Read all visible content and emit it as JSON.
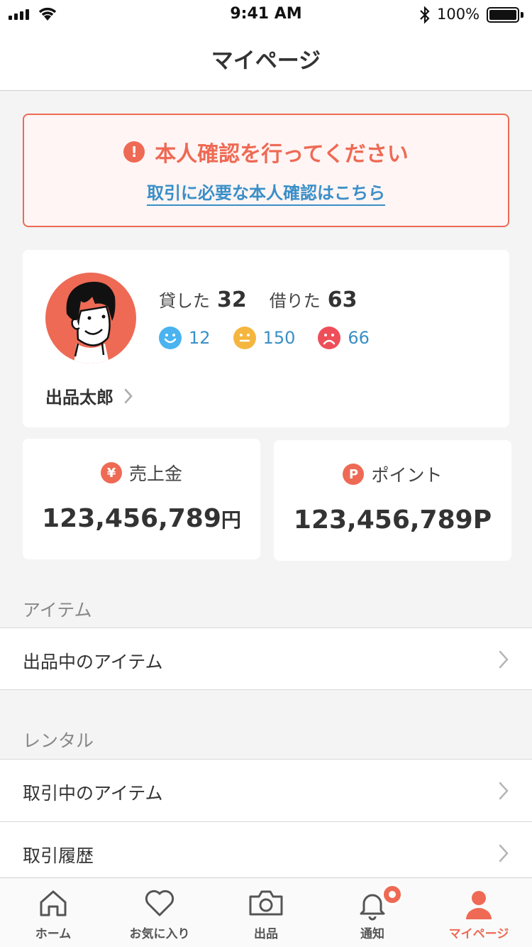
{
  "status_bar": {
    "time": "9:41 AM",
    "battery": "100%"
  },
  "nav": {
    "title": "マイページ"
  },
  "alert": {
    "title": "本人確認を行ってください",
    "link": "取引に必要な本人確認はこちら",
    "icon": "exclamation-icon"
  },
  "profile": {
    "lent_label": "貸した",
    "lent_count": "32",
    "borrowed_label": "借りた",
    "borrowed_count": "63",
    "ratings": {
      "good": "12",
      "normal": "150",
      "bad": "66"
    },
    "username": "出品太郎"
  },
  "sales": {
    "label": "売上金",
    "icon": "¥",
    "value": "123,456,789",
    "unit": "円"
  },
  "points": {
    "label": "ポイント",
    "icon": "P",
    "value": "123,456,789P"
  },
  "sections": {
    "items": {
      "title": "アイテム",
      "rows": [
        "出品中のアイテム"
      ]
    },
    "rental": {
      "title": "レンタル",
      "rows": [
        "取引中のアイテム",
        "取引履歴"
      ]
    }
  },
  "tabs": [
    {
      "label": "ホーム",
      "icon": "home-icon"
    },
    {
      "label": "お気に入り",
      "icon": "heart-icon"
    },
    {
      "label": "出品",
      "icon": "camera-icon"
    },
    {
      "label": "通知",
      "icon": "bell-icon"
    },
    {
      "label": "マイページ",
      "icon": "person-icon"
    }
  ],
  "colors": {
    "accent": "#ee6a55",
    "link": "#3a8fc8",
    "good": "#4ab3f0",
    "normal": "#f5b640",
    "bad": "#ee4e5a"
  }
}
